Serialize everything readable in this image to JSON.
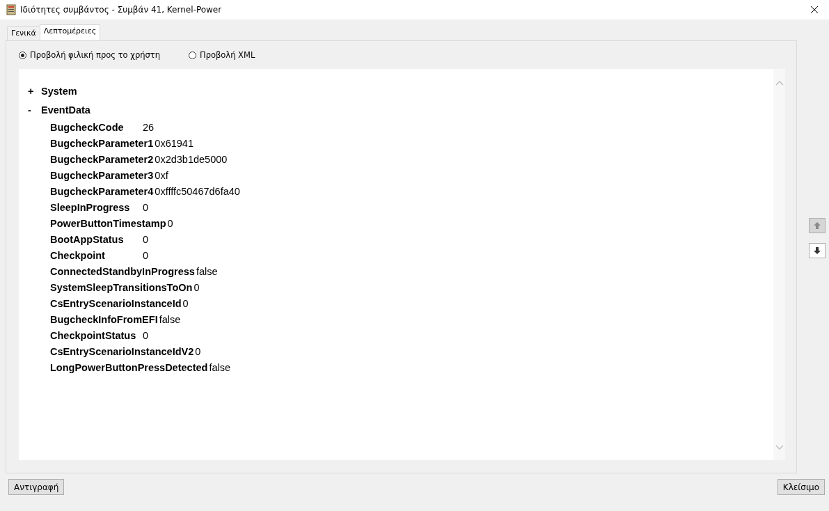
{
  "window": {
    "title": "Ιδιότητες συμβάντος - Συμβάν 41, Kernel-Power"
  },
  "tabs": [
    {
      "label": "Γενικά",
      "selected": false
    },
    {
      "label": "Λεπτομέρειες",
      "selected": true
    }
  ],
  "view_options": [
    {
      "label": "Προβολή φιλική προς το χρήστη",
      "selected": true
    },
    {
      "label": "Προβολή XML",
      "selected": false
    }
  ],
  "tree": [
    {
      "toggle": "+",
      "label": "System"
    },
    {
      "toggle": "-",
      "label": "EventData",
      "fields": [
        {
          "name": "BugcheckCode",
          "value": "26"
        },
        {
          "name": "BugcheckParameter1",
          "value": "0x61941"
        },
        {
          "name": "BugcheckParameter2",
          "value": "0x2d3b1de5000"
        },
        {
          "name": "BugcheckParameter3",
          "value": "0xf"
        },
        {
          "name": "BugcheckParameter4",
          "value": "0xffffc50467d6fa40"
        },
        {
          "name": "SleepInProgress",
          "value": "0"
        },
        {
          "name": "PowerButtonTimestamp",
          "value": "0"
        },
        {
          "name": "BootAppStatus",
          "value": "0"
        },
        {
          "name": "Checkpoint",
          "value": "0"
        },
        {
          "name": "ConnectedStandbyInProgress",
          "value": "false"
        },
        {
          "name": "SystemSleepTransitionsToOn",
          "value": "0"
        },
        {
          "name": "CsEntryScenarioInstanceId",
          "value": "0"
        },
        {
          "name": "BugcheckInfoFromEFI",
          "value": "false"
        },
        {
          "name": "CheckpointStatus",
          "value": "0"
        },
        {
          "name": "CsEntryScenarioInstanceIdV2",
          "value": "0"
        },
        {
          "name": "LongPowerButtonPressDetected",
          "value": "false"
        }
      ]
    }
  ],
  "nav_buttons": [
    {
      "kind": "up",
      "disabled": true
    },
    {
      "kind": "down",
      "disabled": false
    }
  ],
  "buttons": [
    {
      "label": "Αντιγραφή"
    },
    {
      "label": "Κλείσιμο"
    }
  ]
}
